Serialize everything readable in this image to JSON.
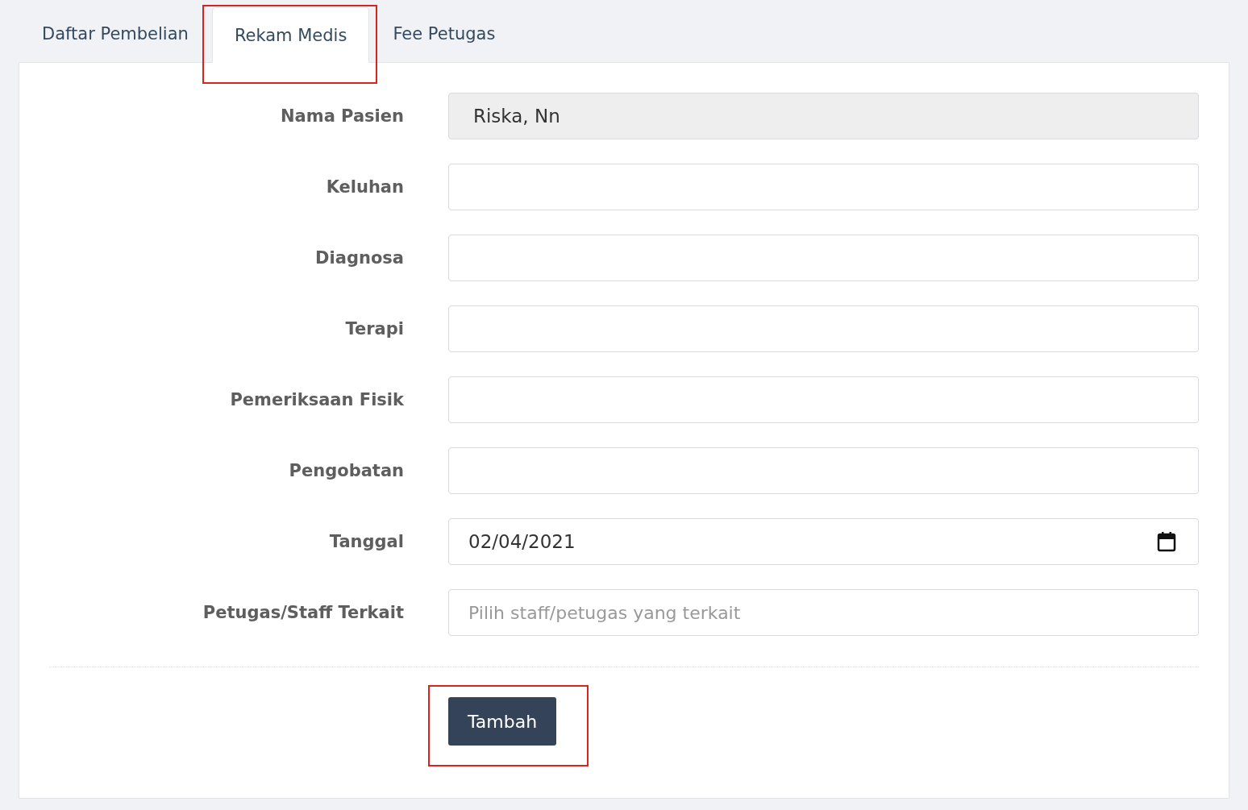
{
  "tabs": [
    {
      "label": "Daftar Pembelian",
      "selected": false,
      "highlighted": false
    },
    {
      "label": "Rekam Medis",
      "selected": true,
      "highlighted": true
    },
    {
      "label": "Fee Petugas",
      "selected": false,
      "highlighted": false
    }
  ],
  "form": {
    "fields": [
      {
        "label": "Nama Pasien",
        "kind": "text",
        "value": "Riska, Nn",
        "readonly": true
      },
      {
        "label": "Keluhan",
        "kind": "text",
        "readonly": false
      },
      {
        "label": "Diagnosa",
        "kind": "text",
        "readonly": false
      },
      {
        "label": "Terapi",
        "kind": "text",
        "readonly": false
      },
      {
        "label": "Pemeriksaan Fisik",
        "kind": "text",
        "readonly": false
      },
      {
        "label": "Pengobatan",
        "kind": "text",
        "readonly": false
      },
      {
        "label": "Tanggal",
        "kind": "date",
        "value": "02/04/2021",
        "readonly": false
      },
      {
        "label": "Petugas/Staff Terkait",
        "kind": "select",
        "placeholder": "Pilih staff/petugas yang terkait",
        "readonly": false
      }
    ]
  },
  "submit": {
    "label": "Tambah",
    "highlighted": true
  }
}
